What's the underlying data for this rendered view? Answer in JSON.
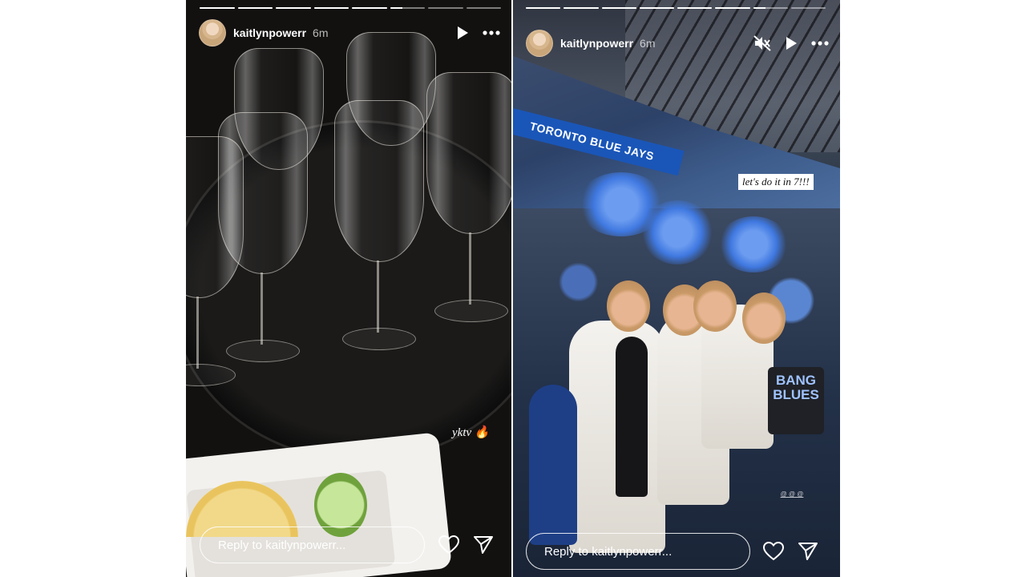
{
  "stories": [
    {
      "username": "kaitlynpowerr",
      "time": "6m",
      "progress": [
        1,
        1,
        1,
        1,
        1,
        0.35,
        0,
        0
      ],
      "caption": "yktv 🔥",
      "reply_placeholder": "Reply to kaitlynpowerr..."
    },
    {
      "username": "kaitlynpowerr",
      "time": "6m",
      "progress": [
        1,
        1,
        1,
        1,
        1,
        1,
        0.35,
        0
      ],
      "banner_text": "TORONTO BLUE JAYS",
      "caption": "let's do it in 7!!!",
      "bag_text": "BANG BLUES",
      "reply_placeholder": "Reply to kaitlynpowerr..."
    }
  ],
  "icons": {
    "play": "play-icon",
    "more": "more-icon",
    "mute": "muted-speaker-icon",
    "like": "heart-icon",
    "share": "send-icon"
  },
  "colors": {
    "page_background": "#ffffff",
    "text": "#ffffff",
    "jays_blue": "#1a56b8"
  }
}
